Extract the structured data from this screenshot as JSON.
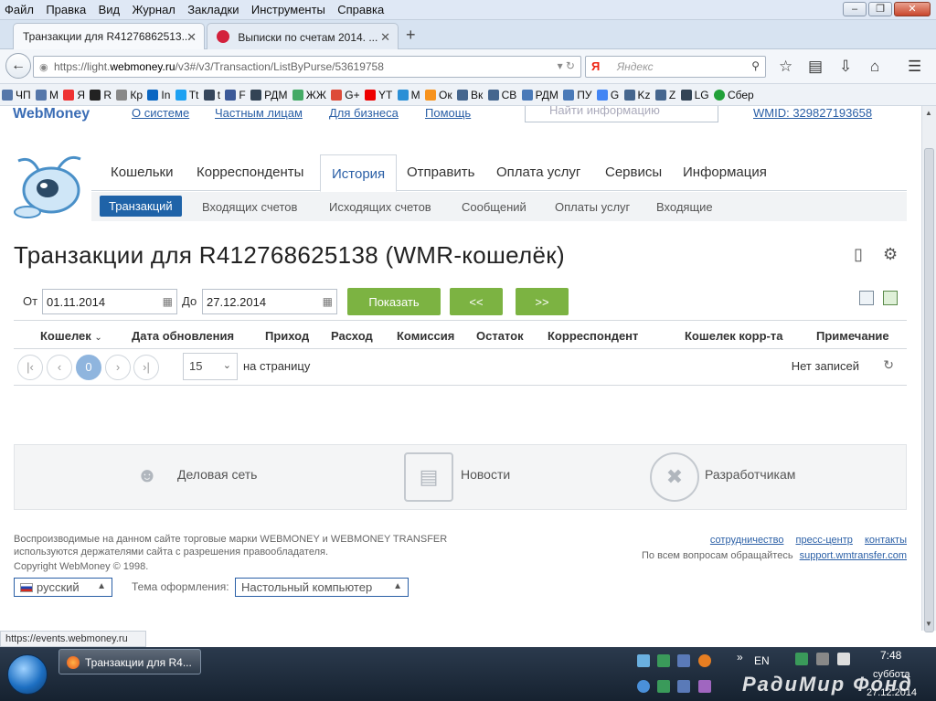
{
  "browser": {
    "menu": [
      "Файл",
      "Правка",
      "Вид",
      "Журнал",
      "Закладки",
      "Инструменты",
      "Справка"
    ],
    "tabs": [
      {
        "title": "Транзакции для R41276862513..."
      },
      {
        "title": "Выписки по счетам 2014. ..."
      }
    ],
    "url_prefix": "https://light.",
    "url_host": "webmoney.ru",
    "url_path": "/v3#/v3/Transaction/ListByPurse/53619758",
    "search_placeholder": "Яндекс",
    "search_engine_label": "Я",
    "bookmarks": [
      "ЧП",
      "М",
      "Я",
      "R",
      "Кр",
      "In",
      "Tt",
      "t",
      "F",
      "РДМ",
      "ЖЖ",
      "G+",
      "YT",
      "М",
      "Ок",
      "Вк",
      "СВ",
      "РДМ",
      "ПУ",
      "G",
      "Kz",
      "Z",
      "LG",
      "Сбер"
    ]
  },
  "site": {
    "logo": "WebMoney",
    "top_links": [
      "О системе",
      "Частным лицам",
      "Для бизнеса",
      "Помощь"
    ],
    "search_placeholder": "Найти информацию",
    "wmid": "WMID: 329827193658",
    "main_tabs": [
      "Кошельки",
      "Корреспонденты",
      "История",
      "Отправить",
      "Оплата услуг",
      "Сервисы",
      "Информация"
    ],
    "main_tab_selected": "История",
    "sub_tabs": [
      "Транзакций",
      "Входящих счетов",
      "Исходящих счетов",
      "Сообщений",
      "Оплаты услуг",
      "Входящие"
    ],
    "sub_tab_selected": "Транзакций"
  },
  "page": {
    "title": "Транзакции для R412768625138 (WMR-кошелёк)",
    "filter": {
      "from_label": "От",
      "from_value": "01.11.2014",
      "to_label": "До",
      "to_value": "27.12.2014",
      "show_button": "Показать",
      "prev_button": "<<",
      "next_button": ">>"
    },
    "columns": [
      "Кошелек",
      "Дата обновления",
      "Приход",
      "Расход",
      "Комиссия",
      "Остаток",
      "Корреспондент",
      "Кошелек корр-та",
      "Примечание"
    ],
    "pager": {
      "current_page": "0",
      "per_page": "15",
      "per_page_label": "на страницу",
      "no_records": "Нет записей"
    },
    "promo": [
      "Деловая сеть",
      "Новости",
      "Разработчикам"
    ]
  },
  "footer": {
    "notice": "Воспроизводимые на данном сайте торговые марки WEBMONEY и WEBMONEY TRANSFER используются держателями сайта с разрешения правообладателя.",
    "copyright": "Copyright WebMoney © 1998.",
    "links": [
      "сотрудничество",
      "пресс-центр",
      "контакты"
    ],
    "contact_text": "По всем вопросам обращайтесь",
    "contact_link": "support.wmtransfer.com",
    "language": "русский",
    "theme_label": "Тема оформления:",
    "theme_value": "Настольный компьютер"
  },
  "status_url": "https://events.webmoney.ru",
  "taskbar": {
    "task": "Транзакции для R4...",
    "lang": "EN",
    "time": "7:48",
    "day": "суббота",
    "date": "27.12.2014",
    "watermark": "РадиМир Фонд"
  }
}
